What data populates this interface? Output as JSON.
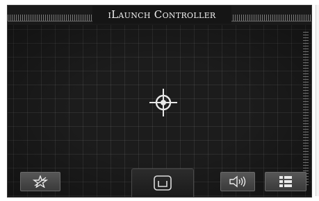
{
  "header": {
    "title": "iLaunch Controller"
  },
  "icons": {
    "target": "crosshair-icon",
    "left_button": "star-shield-icon",
    "center_tab": "cup-holder-icon",
    "sound_button": "speaker-icon",
    "menu_button": "list-menu-icon"
  },
  "colors": {
    "background": "#1a1a1a",
    "grid_line": "#333333",
    "text": "#f2f2f2",
    "button": "#4a4a4a"
  }
}
